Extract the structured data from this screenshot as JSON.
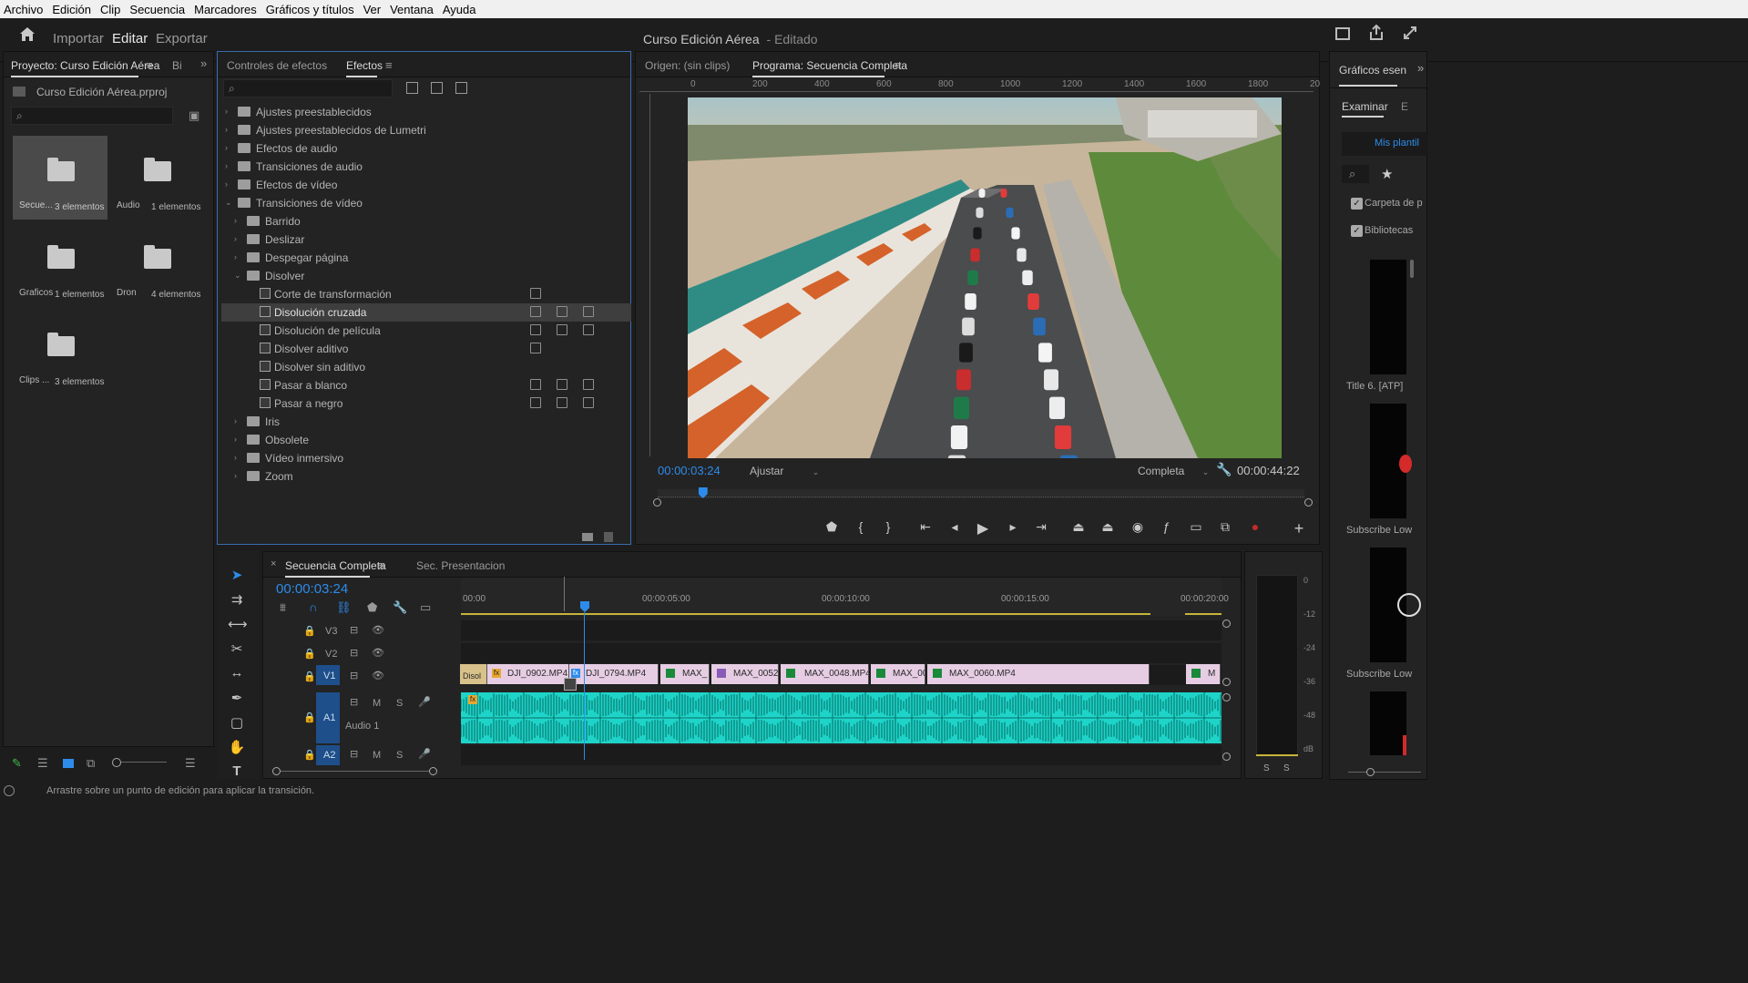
{
  "os_menu": [
    "Archivo",
    "Edición",
    "Clip",
    "Secuencia",
    "Marcadores",
    "Gráficos y títulos",
    "Ver",
    "Ventana",
    "Ayuda"
  ],
  "header": {
    "tabs": {
      "import": "Importar",
      "edit": "Editar",
      "export": "Exportar"
    },
    "project_title": "Curso Edición Aérea",
    "status": "- Editado"
  },
  "project_panel": {
    "tab": "Proyecto: Curso Edición Aérea",
    "tab2": "Bi",
    "file": "Curso Edición Aérea.prproj",
    "bins": [
      {
        "name": "Secue...",
        "count": "3 elementos"
      },
      {
        "name": "Audio",
        "count": "1 elementos"
      },
      {
        "name": "Graficos",
        "count": "1 elementos"
      },
      {
        "name": "Dron",
        "count": "4 elementos"
      },
      {
        "name": "Clips ...",
        "count": "3 elementos"
      }
    ]
  },
  "effects_panel": {
    "tab_controls": "Controles de efectos",
    "tab_effects": "Efectos",
    "tree": [
      {
        "label": "Ajustes preestablecidos",
        "level": 0,
        "kind": "folder"
      },
      {
        "label": "Ajustes preestablecidos de Lumetri",
        "level": 0,
        "kind": "folder"
      },
      {
        "label": "Efectos de audio",
        "level": 0,
        "kind": "folder"
      },
      {
        "label": "Transiciones de audio",
        "level": 0,
        "kind": "folder"
      },
      {
        "label": "Efectos de vídeo",
        "level": 0,
        "kind": "folder"
      },
      {
        "label": "Transiciones de vídeo",
        "level": 0,
        "kind": "folder-open"
      },
      {
        "label": "Barrido",
        "level": 1,
        "kind": "folder"
      },
      {
        "label": "Deslizar",
        "level": 1,
        "kind": "folder"
      },
      {
        "label": "Despegar página",
        "level": 1,
        "kind": "folder"
      },
      {
        "label": "Disolver",
        "level": 1,
        "kind": "folder-open"
      },
      {
        "label": "Corte de transformación",
        "level": 2,
        "kind": "fx",
        "badges": 1
      },
      {
        "label": "Disolución cruzada",
        "level": 2,
        "kind": "fx",
        "badges": 3,
        "selected": true
      },
      {
        "label": "Disolución de película",
        "level": 2,
        "kind": "fx",
        "badges": 3
      },
      {
        "label": "Disolver aditivo",
        "level": 2,
        "kind": "fx",
        "badges": 1
      },
      {
        "label": "Disolver sin aditivo",
        "level": 2,
        "kind": "fx",
        "badges": 0
      },
      {
        "label": "Pasar a blanco",
        "level": 2,
        "kind": "fx",
        "badges": 3
      },
      {
        "label": "Pasar a negro",
        "level": 2,
        "kind": "fx",
        "badges": 3
      },
      {
        "label": "Iris",
        "level": 1,
        "kind": "folder"
      },
      {
        "label": "Obsolete",
        "level": 1,
        "kind": "folder"
      },
      {
        "label": "Vídeo inmersivo",
        "level": 1,
        "kind": "folder"
      },
      {
        "label": "Zoom",
        "level": 1,
        "kind": "folder"
      }
    ]
  },
  "monitor": {
    "tab_source": "Origen: (sin clips)",
    "tab_program": "Programa: Secuencia Completa",
    "ruler": [
      "0",
      "200",
      "400",
      "600",
      "800",
      "1000",
      "1200",
      "1400",
      "1600",
      "1800",
      "20"
    ],
    "timecode": "00:00:03:24",
    "fit": "Ajustar",
    "quality": "Completa",
    "duration": "00:00:44:22",
    "playhead_fraction": 0.07
  },
  "timeline": {
    "tab_active": "Secuencia Completa",
    "tab_other": "Sec. Presentacion",
    "timecode": "00:00:03:24",
    "ruler": [
      "00:00",
      "00:00:05:00",
      "00:00:10:00",
      "00:00:15:00",
      "00:00:20:00"
    ],
    "tracks": {
      "v3": "V3",
      "v2": "V2",
      "v1": "V1",
      "a1": "A1",
      "a2": "A2",
      "audio1": "Audio 1",
      "m": "M",
      "s": "S"
    },
    "clips": [
      "DJI_0902.MP4",
      "DJI_0794.MP4",
      "MAX_",
      "MAX_0052.",
      "MAX_0048.MP4 [",
      "MAX_00",
      "MAX_0060.MP4",
      "M"
    ],
    "transition_label": "Disol",
    "fx_badge": "fx"
  },
  "meters": {
    "scale": [
      "0",
      "-12",
      "-24",
      "-36",
      "-48",
      "dB"
    ],
    "solo": [
      "S",
      "S"
    ]
  },
  "graphics_panel": {
    "title": "Gráficos esen",
    "tab": "Examinar",
    "tab2": "E",
    "my_templates": "Mis plantil",
    "checkbox1": "Carpeta de p",
    "checkbox2": "Bibliotecas",
    "items": [
      "Title 6. [ATP]",
      "Subscribe Low",
      "Subscribe Low"
    ]
  },
  "status_bar": "Arrastre sobre un punto de edición para aplicar la transición.",
  "colors": {
    "accent_blue": "#2d8ceb",
    "audio_clip": "#1ed4c8",
    "video_clip": "#e6cde3",
    "record_red": "#c42a2a"
  }
}
